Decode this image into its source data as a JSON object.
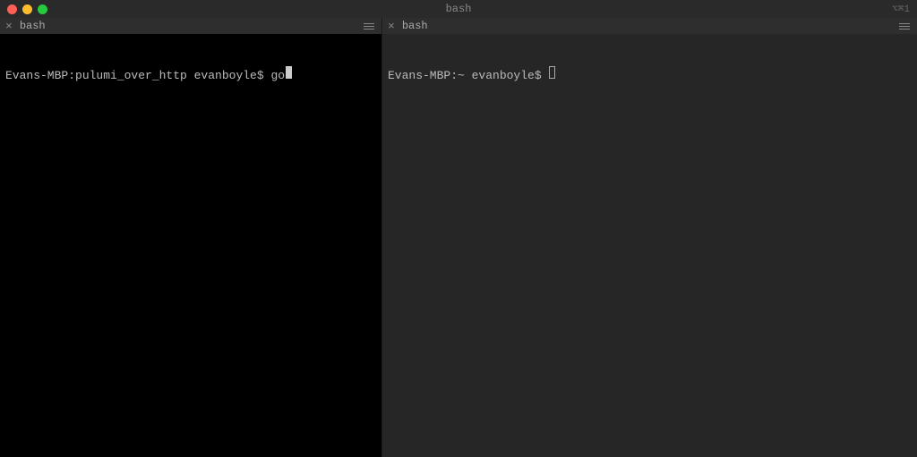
{
  "titlebar": {
    "title": "bash",
    "right_text": "⌥⌘1"
  },
  "panes": {
    "left": {
      "tab_label": "bash",
      "prompt": "Evans-MBP:pulumi_over_http evanboyle$ ",
      "input": "go"
    },
    "right": {
      "tab_label": "bash",
      "prompt": "Evans-MBP:~ evanboyle$ ",
      "input": ""
    }
  }
}
